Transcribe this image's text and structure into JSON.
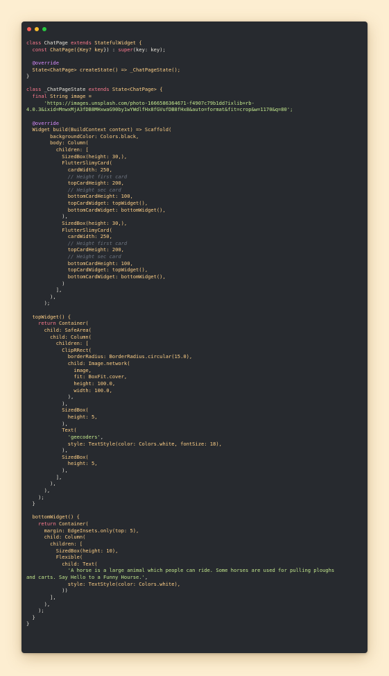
{
  "window": {
    "controls": [
      "close",
      "minimize",
      "maximize"
    ],
    "language": "dart"
  },
  "colors": {
    "background": "#fdeed1",
    "editor": "#272a2f",
    "keyword": "#ff7b8f",
    "type": "#ffd087",
    "string": "#c3e88d",
    "annotation": "#d98cff",
    "comment": "#6f7682",
    "text": "#e8e4da"
  },
  "code_lines": [
    [
      {
        "t": "class",
        "c": "kw"
      },
      {
        "t": " ChatPage "
      },
      {
        "t": "extends",
        "c": "kw"
      },
      {
        "t": " StatefulWidget {",
        "c": "ty"
      }
    ],
    [
      {
        "t": "  "
      },
      {
        "t": "const",
        "c": "kw"
      },
      {
        "t": " ChatPage({",
        "c": "ty"
      },
      {
        "t": "Key? key",
        "c": "ty"
      },
      {
        "t": "}) : "
      },
      {
        "t": "super",
        "c": "kw"
      },
      {
        "t": "(key: key);"
      }
    ],
    [],
    [
      {
        "t": "  @override",
        "c": "at"
      }
    ],
    [
      {
        "t": "  State<ChatPage> createState() => _ChatPageState();",
        "c": "ty"
      }
    ],
    [
      {
        "t": "}"
      }
    ],
    [],
    [
      {
        "t": "class",
        "c": "kw"
      },
      {
        "t": " _ChatPageState "
      },
      {
        "t": "extends",
        "c": "kw"
      },
      {
        "t": " State<ChatPage> {",
        "c": "ty"
      }
    ],
    [
      {
        "t": "  "
      },
      {
        "t": "final",
        "c": "kw"
      },
      {
        "t": " String image =",
        "c": "ty"
      }
    ],
    [
      {
        "t": "      "
      },
      {
        "t": "'https://images.unsplash.com/photo-1666586364671-f4907c79b1dd?ixlib=rb-",
        "c": "st"
      }
    ],
    [
      {
        "t": "4.0.3&ixid=MnwxMjA3fDB8MHxwaG90by1wYWdlfHx8fGVufDB8fHx8&auto=format&fit=crop&w=1170&q=80';",
        "c": "st"
      }
    ],
    [],
    [
      {
        "t": "  @override",
        "c": "at"
      }
    ],
    [
      {
        "t": "  Widget build(BuildContext context) => Scaffold(",
        "c": "ty"
      }
    ],
    [
      {
        "t": "        backgroundColor: Colors.black,",
        "c": "ty"
      }
    ],
    [
      {
        "t": "        body: Column(",
        "c": "ty"
      }
    ],
    [
      {
        "t": "          children: [",
        "c": "ty"
      }
    ],
    [
      {
        "t": "            SizedBox(height: 30,),",
        "c": "ty"
      }
    ],
    [
      {
        "t": "            FlutterSlimyCard(",
        "c": "ty"
      }
    ],
    [
      {
        "t": "              cardWidth: 250,",
        "c": "ty"
      }
    ],
    [
      {
        "t": "              // Height first card",
        "c": "cm"
      }
    ],
    [
      {
        "t": "              topCardHeight: 200,",
        "c": "ty"
      }
    ],
    [
      {
        "t": "              // Height sec card",
        "c": "cm"
      }
    ],
    [
      {
        "t": "              bottomCardHeight: 100,",
        "c": "ty"
      }
    ],
    [
      {
        "t": "              topCardWidget: topWidget(),",
        "c": "ty"
      }
    ],
    [
      {
        "t": "              bottomCardWidget: bottomWidget(),",
        "c": "ty"
      }
    ],
    [
      {
        "t": "            ),"
      }
    ],
    [
      {
        "t": "            SizedBox(height: 30,),",
        "c": "ty"
      }
    ],
    [
      {
        "t": "            FlutterSlimyCard(",
        "c": "ty"
      }
    ],
    [
      {
        "t": "              cardWidth: 250,",
        "c": "ty"
      }
    ],
    [
      {
        "t": "              // Height first card",
        "c": "cm"
      }
    ],
    [
      {
        "t": "              topCardHeight: 200,",
        "c": "ty"
      }
    ],
    [
      {
        "t": "              // Height sec card",
        "c": "cm"
      }
    ],
    [
      {
        "t": "              bottomCardHeight: 100,",
        "c": "ty"
      }
    ],
    [
      {
        "t": "              topCardWidget: topWidget(),",
        "c": "ty"
      }
    ],
    [
      {
        "t": "              bottomCardWidget: bottomWidget(),",
        "c": "ty"
      }
    ],
    [
      {
        "t": "            )"
      }
    ],
    [
      {
        "t": "          ],"
      }
    ],
    [
      {
        "t": "        ),"
      }
    ],
    [
      {
        "t": "      );"
      }
    ],
    [],
    [
      {
        "t": "  topWidget() {",
        "c": "ty"
      }
    ],
    [
      {
        "t": "    "
      },
      {
        "t": "return",
        "c": "kw"
      },
      {
        "t": " Container(",
        "c": "ty"
      }
    ],
    [
      {
        "t": "      child: SafeArea(",
        "c": "ty"
      }
    ],
    [
      {
        "t": "        child: Column(",
        "c": "ty"
      }
    ],
    [
      {
        "t": "          children: [",
        "c": "ty"
      }
    ],
    [
      {
        "t": "            ClipRRect(",
        "c": "ty"
      }
    ],
    [
      {
        "t": "              borderRadius: BorderRadius.circular(15.0),",
        "c": "ty"
      }
    ],
    [
      {
        "t": "              child: Image.network(",
        "c": "ty"
      }
    ],
    [
      {
        "t": "                image,",
        "c": "ty"
      }
    ],
    [
      {
        "t": "                fit: BoxFit.cover,",
        "c": "ty"
      }
    ],
    [
      {
        "t": "                height: 100.0,",
        "c": "ty"
      }
    ],
    [
      {
        "t": "                width: 100.0,",
        "c": "ty"
      }
    ],
    [
      {
        "t": "              ),"
      }
    ],
    [
      {
        "t": "            ),"
      }
    ],
    [
      {
        "t": "            SizedBox(",
        "c": "ty"
      }
    ],
    [
      {
        "t": "              height: 5,",
        "c": "ty"
      }
    ],
    [
      {
        "t": "            ),"
      }
    ],
    [
      {
        "t": "            Text(",
        "c": "ty"
      }
    ],
    [
      {
        "t": "              "
      },
      {
        "t": "'geecoders'",
        "c": "st"
      },
      {
        "t": ","
      }
    ],
    [
      {
        "t": "              style: TextStyle(color: Colors.white, fontSize: 18),",
        "c": "ty"
      }
    ],
    [
      {
        "t": "            ),"
      }
    ],
    [
      {
        "t": "            SizedBox(",
        "c": "ty"
      }
    ],
    [
      {
        "t": "              height: 5,",
        "c": "ty"
      }
    ],
    [
      {
        "t": "            ),"
      }
    ],
    [
      {
        "t": "          ],"
      }
    ],
    [
      {
        "t": "        ),"
      }
    ],
    [
      {
        "t": "      ),"
      }
    ],
    [
      {
        "t": "    );"
      }
    ],
    [
      {
        "t": "  }"
      }
    ],
    [],
    [
      {
        "t": "  bottomWidget() {",
        "c": "ty"
      }
    ],
    [
      {
        "t": "    "
      },
      {
        "t": "return",
        "c": "kw"
      },
      {
        "t": " Container(",
        "c": "ty"
      }
    ],
    [
      {
        "t": "      margin: EdgeInsets.only(top: 5),",
        "c": "ty"
      }
    ],
    [
      {
        "t": "      child: Column(",
        "c": "ty"
      }
    ],
    [
      {
        "t": "        children: [",
        "c": "ty"
      }
    ],
    [
      {
        "t": "          SizedBox(height: 10),",
        "c": "ty"
      }
    ],
    [
      {
        "t": "          Flexible(",
        "c": "ty"
      }
    ],
    [
      {
        "t": "            child: Text(",
        "c": "ty"
      }
    ],
    [
      {
        "t": "              "
      },
      {
        "t": "'A horse is a large animal which people can ride. Some horses are used for pulling ploughs",
        "c": "st"
      }
    ],
    [
      {
        "t": "and carts. Say Hello to a Funny Hourse.'",
        "c": "st"
      },
      {
        "t": ","
      }
    ],
    [
      {
        "t": "              style: TextStyle(color: Colors.white),",
        "c": "ty"
      }
    ],
    [
      {
        "t": "            ))"
      }
    ],
    [
      {
        "t": "        ],"
      }
    ],
    [
      {
        "t": "      ),"
      }
    ],
    [
      {
        "t": "    );"
      }
    ],
    [
      {
        "t": "  }"
      }
    ],
    [
      {
        "t": "}"
      }
    ]
  ]
}
